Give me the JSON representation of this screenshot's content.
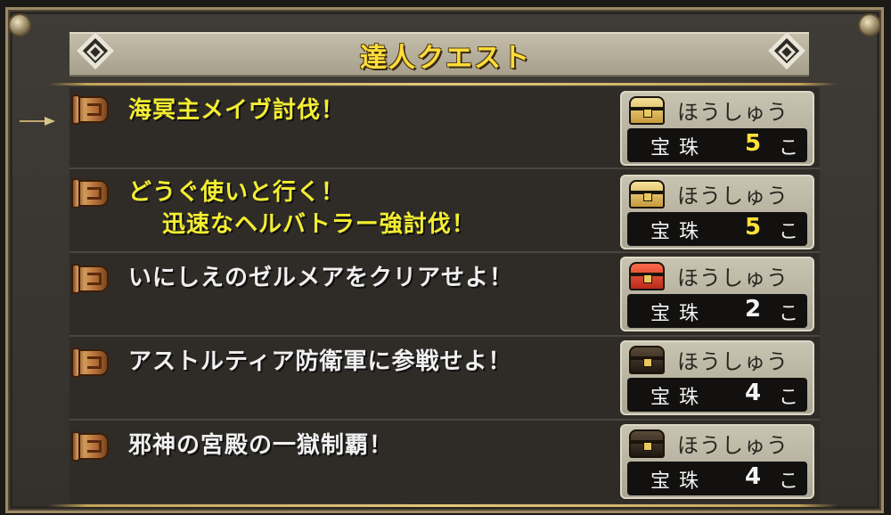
{
  "panel": {
    "title": "達人クエスト"
  },
  "reward_label": "ほうしゅう",
  "quests": [
    {
      "title_line1": "海冥主メイヴ討伐！",
      "title_line2": "",
      "is_new": true,
      "reward_item": "宝珠",
      "reward_qty": "5",
      "reward_unit": "こ",
      "chest": "gold-chest-icon",
      "qty_color": "#ffe23a"
    },
    {
      "title_line1": "どうぐ使いと行く！",
      "title_line2": "迅速なヘルバトラー強討伐！",
      "is_new": true,
      "reward_item": "宝珠",
      "reward_qty": "5",
      "reward_unit": "こ",
      "chest": "gold-chest-icon",
      "qty_color": "#ffe23a"
    },
    {
      "title_line1": "いにしえのゼルメアをクリアせよ！",
      "title_line2": "",
      "is_new": false,
      "reward_item": "宝珠",
      "reward_qty": "2",
      "reward_unit": "こ",
      "chest": "red-chest-icon",
      "qty_color": "#f4f4f4"
    },
    {
      "title_line1": "アストルティア防衛軍に参戦せよ！",
      "title_line2": "",
      "is_new": false,
      "reward_item": "宝珠",
      "reward_qty": "4",
      "reward_unit": "こ",
      "chest": "black-chest-icon",
      "qty_color": "#f4f4f4"
    },
    {
      "title_line1": "邪神の宮殿の一獄制覇！",
      "title_line2": "",
      "is_new": false,
      "reward_item": "宝珠",
      "reward_qty": "4",
      "reward_unit": "こ",
      "chest": "black-chest-icon",
      "qty_color": "#f4f4f4"
    }
  ]
}
